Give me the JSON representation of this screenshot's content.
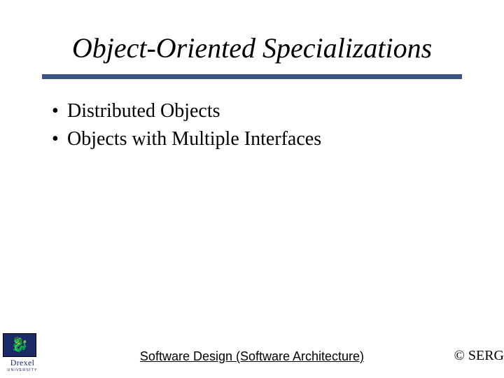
{
  "title": "Object-Oriented Specializations",
  "bullets": [
    "Distributed Objects",
    "Objects with Multiple Interfaces"
  ],
  "footer": {
    "center": "Software Design (Software Architecture)",
    "right": "© SERG"
  },
  "logo": {
    "name": "Drexel",
    "sub": "UNIVERSITY",
    "glyph": "🐉"
  },
  "colors": {
    "rule": "#3c5484",
    "logo_bg": "#1a2a66",
    "logo_gold": "#d9a400"
  }
}
